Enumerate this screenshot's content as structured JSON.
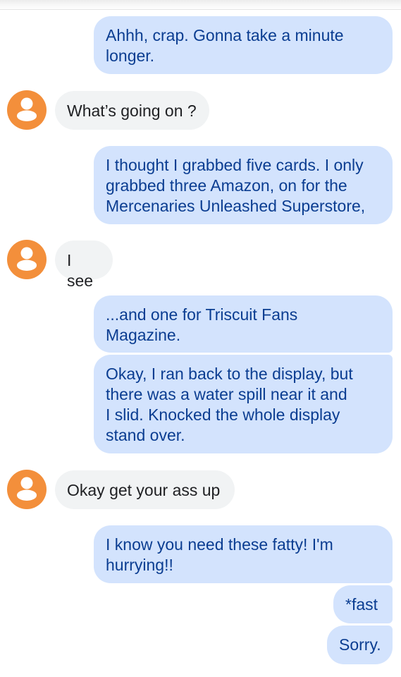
{
  "conversation": {
    "messages": [
      {
        "direction": "outgoing",
        "text": "Ahhh, crap.  Gonna take a minute\nlonger."
      },
      {
        "direction": "incoming",
        "text": "What’s going on ?"
      },
      {
        "direction": "outgoing",
        "text": "I thought I grabbed five cards. I only\ngrabbed three Amazon, on for the\nMercenaries Unleashed Superstore,"
      },
      {
        "direction": "incoming",
        "text": "I see"
      },
      {
        "direction": "outgoing",
        "text": "...and one for Triscuit Fans\nMagazine."
      },
      {
        "direction": "outgoing",
        "text": "Okay, I ran back to the display, but\nthere was a water spill near it and\nI slid.  Knocked the whole display\nstand over."
      },
      {
        "direction": "incoming",
        "text": "Okay get your ass up"
      },
      {
        "direction": "outgoing",
        "text": "I know you need these fatty!  I'm\nhurrying!!"
      },
      {
        "direction": "outgoing",
        "text": "*fast"
      },
      {
        "direction": "outgoing",
        "text": "Sorry."
      }
    ]
  },
  "colors": {
    "outgoing_bubble": "#d3e3fd",
    "outgoing_text": "#0b3d91",
    "incoming_bubble": "#f1f3f4",
    "incoming_text": "#202124",
    "avatar": "#f38f3b"
  },
  "icons": {
    "avatar": "person-icon"
  }
}
